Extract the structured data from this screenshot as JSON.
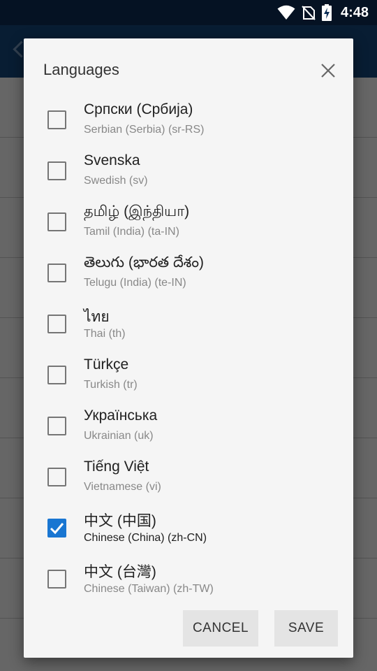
{
  "status_bar": {
    "time": "4:48",
    "icons": [
      "wifi-icon",
      "no-sim-icon",
      "battery-charging-icon"
    ]
  },
  "dialog": {
    "title": "Languages",
    "close_icon": "close-icon",
    "languages": [
      {
        "name": "Српски (Србија)",
        "subtitle": "Serbian (Serbia) (sr-RS)",
        "checked": false
      },
      {
        "name": "Svenska",
        "subtitle": "Swedish (sv)",
        "checked": false
      },
      {
        "name": "தமிழ் (இந்தியா)",
        "subtitle": "Tamil (India) (ta-IN)",
        "checked": false
      },
      {
        "name": "తెలుగు (భారత దేశం)",
        "subtitle": "Telugu (India) (te-IN)",
        "checked": false
      },
      {
        "name": "ไทย",
        "subtitle": "Thai (th)",
        "checked": false
      },
      {
        "name": "Türkçe",
        "subtitle": "Turkish (tr)",
        "checked": false
      },
      {
        "name": "Українська",
        "subtitle": "Ukrainian (uk)",
        "checked": false
      },
      {
        "name": "Tiếng Việt",
        "subtitle": "Vietnamese (vi)",
        "checked": false
      },
      {
        "name": "中文 (中国)",
        "subtitle": "Chinese (China) (zh-CN)",
        "checked": true
      },
      {
        "name": "中文 (台灣)",
        "subtitle": "Chinese (Taiwan) (zh-TW)",
        "checked": false
      }
    ],
    "cancel_label": "CANCEL",
    "save_label": "SAVE"
  },
  "colors": {
    "accent": "#1976d2",
    "toolbar": "#164a80",
    "status_bar": "#0d2f57"
  }
}
